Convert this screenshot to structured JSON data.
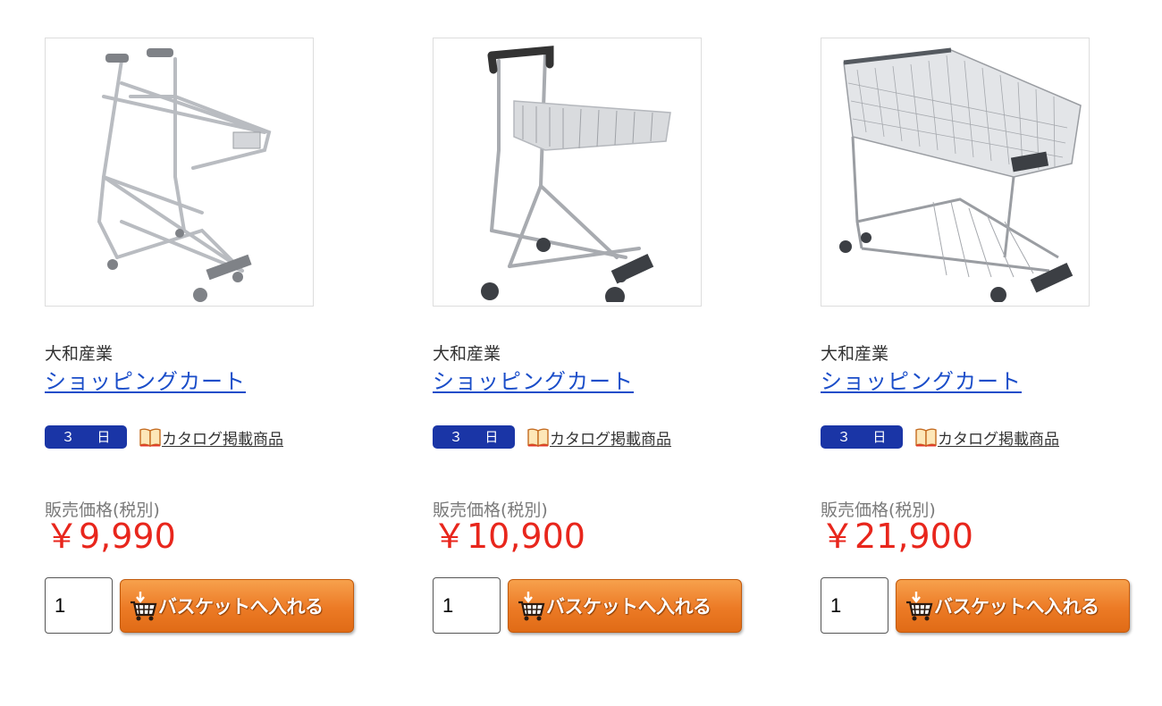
{
  "products": [
    {
      "image_alt": "cart-basket-type",
      "maker": "大和産業",
      "name": "ショッピングカート",
      "delivery_badge": "３ 日",
      "catalog_label": "カタログ掲載商品",
      "price_label": "販売価格(税別)",
      "price": "￥9,990",
      "quantity": "1",
      "basket_button": "バスケットへ入れる"
    },
    {
      "image_alt": "cart-mini-basket",
      "maker": "大和産業",
      "name": "ショッピングカート",
      "delivery_badge": "３ 日",
      "catalog_label": "カタログ掲載商品",
      "price_label": "販売価格(税別)",
      "price": "￥10,900",
      "quantity": "1",
      "basket_button": "バスケットへ入れる"
    },
    {
      "image_alt": "cart-full-basket",
      "maker": "大和産業",
      "name": "ショッピングカート",
      "delivery_badge": "３ 日",
      "catalog_label": "カタログ掲載商品",
      "price_label": "販売価格(税別)",
      "price": "￥21,900",
      "quantity": "1",
      "basket_button": "バスケットへ入れる"
    }
  ],
  "colors": {
    "link": "#1a4dc9",
    "price": "#e8261c",
    "badge": "#1a35a6",
    "button": "#ec7a25"
  },
  "icons": {
    "catalog": "book-icon",
    "basket": "cart-icon"
  }
}
